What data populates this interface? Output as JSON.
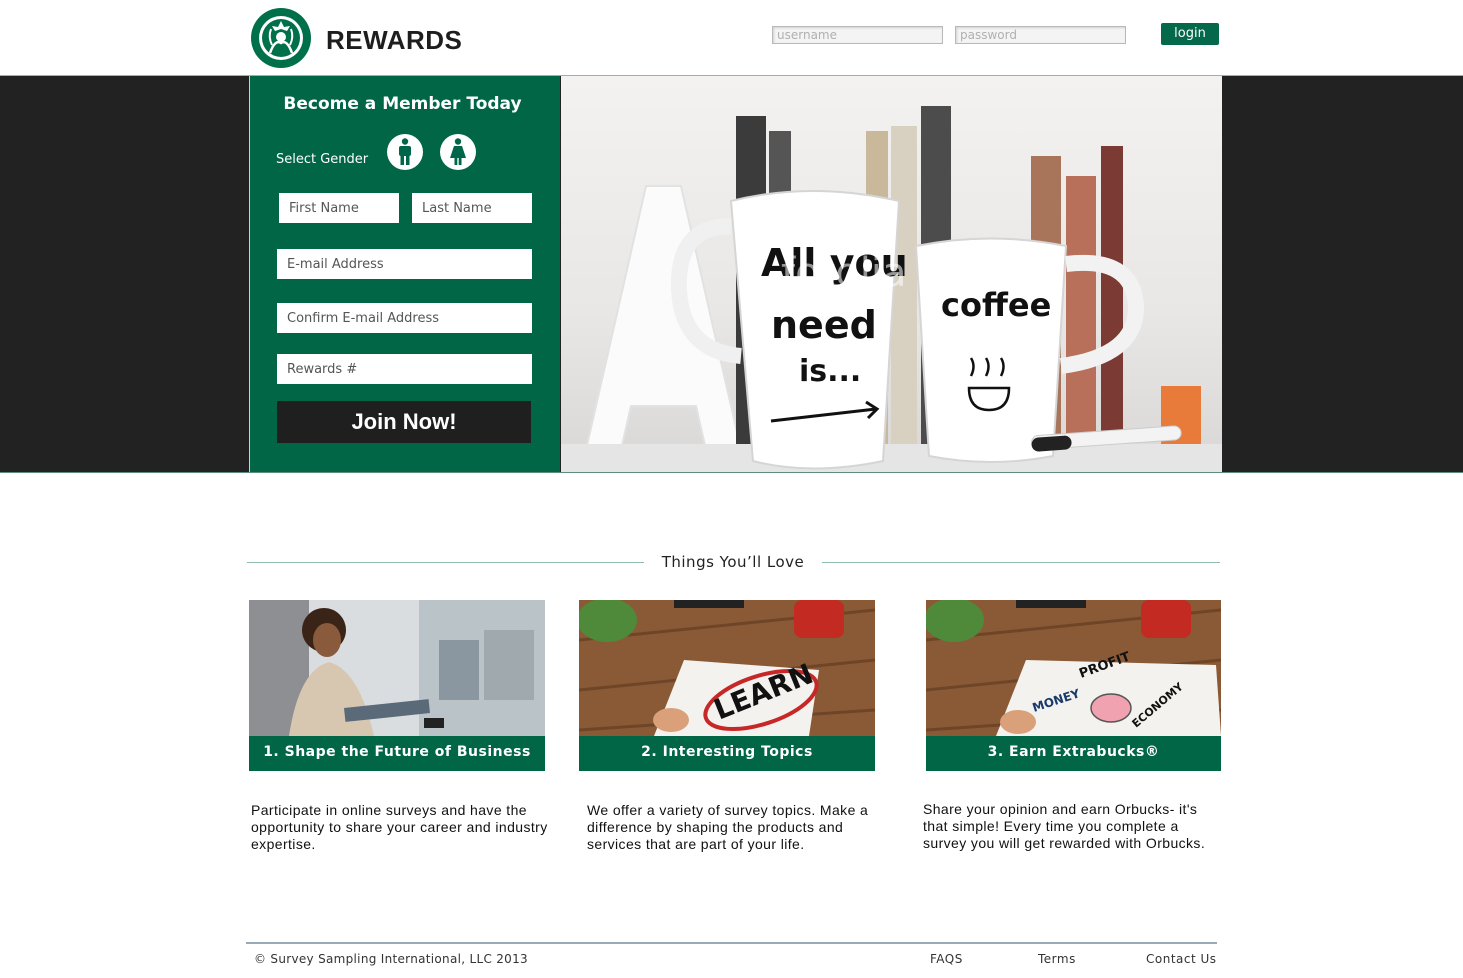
{
  "header": {
    "brand": "REWARDS",
    "username_placeholder": "username",
    "password_placeholder": "password",
    "login_label": "login"
  },
  "signup": {
    "title": "Become a Member Today",
    "gender_label": "Select Gender",
    "first_name_placeholder": "First Name",
    "last_name_placeholder": "Last Name",
    "email_placeholder": "E-mail Address",
    "confirm_email_placeholder": "Confirm E-mail Address",
    "rewards_placeholder": "Rewards #",
    "join_label": "Join Now!"
  },
  "hero": {
    "mug_left_text": [
      "All you",
      "need",
      "is..."
    ],
    "mug_right_text": "coffee",
    "watermark": "fotolia"
  },
  "section": {
    "title": "Things You’ll Love"
  },
  "cards": [
    {
      "title": "1. Shape the Future of Business",
      "description": "Participate in online surveys and have the opportunity to share your career and industry expertise."
    },
    {
      "title": "2. Interesting Topics",
      "description": "We offer a variety of survey topics. Make a difference by shaping the products and services that are part of your life.",
      "photo_text": "LEARN"
    },
    {
      "title": "3. Earn Extrabucks®",
      "description": "Share your opinion and earn Orbucks- it's that simple! Every time you complete a survey you will get rewarded with Orbucks.",
      "photo_text": [
        "MONEY",
        "PROFIT",
        "ECONOMY"
      ]
    }
  ],
  "footer": {
    "copyright": "© Survey Sampling International, LLC 2013",
    "links": [
      "FAQS",
      "Terms",
      "Contact Us"
    ]
  },
  "colors": {
    "brand_green": "#006646",
    "dark_band": "#222222",
    "join_button": "#1f1f1f"
  }
}
